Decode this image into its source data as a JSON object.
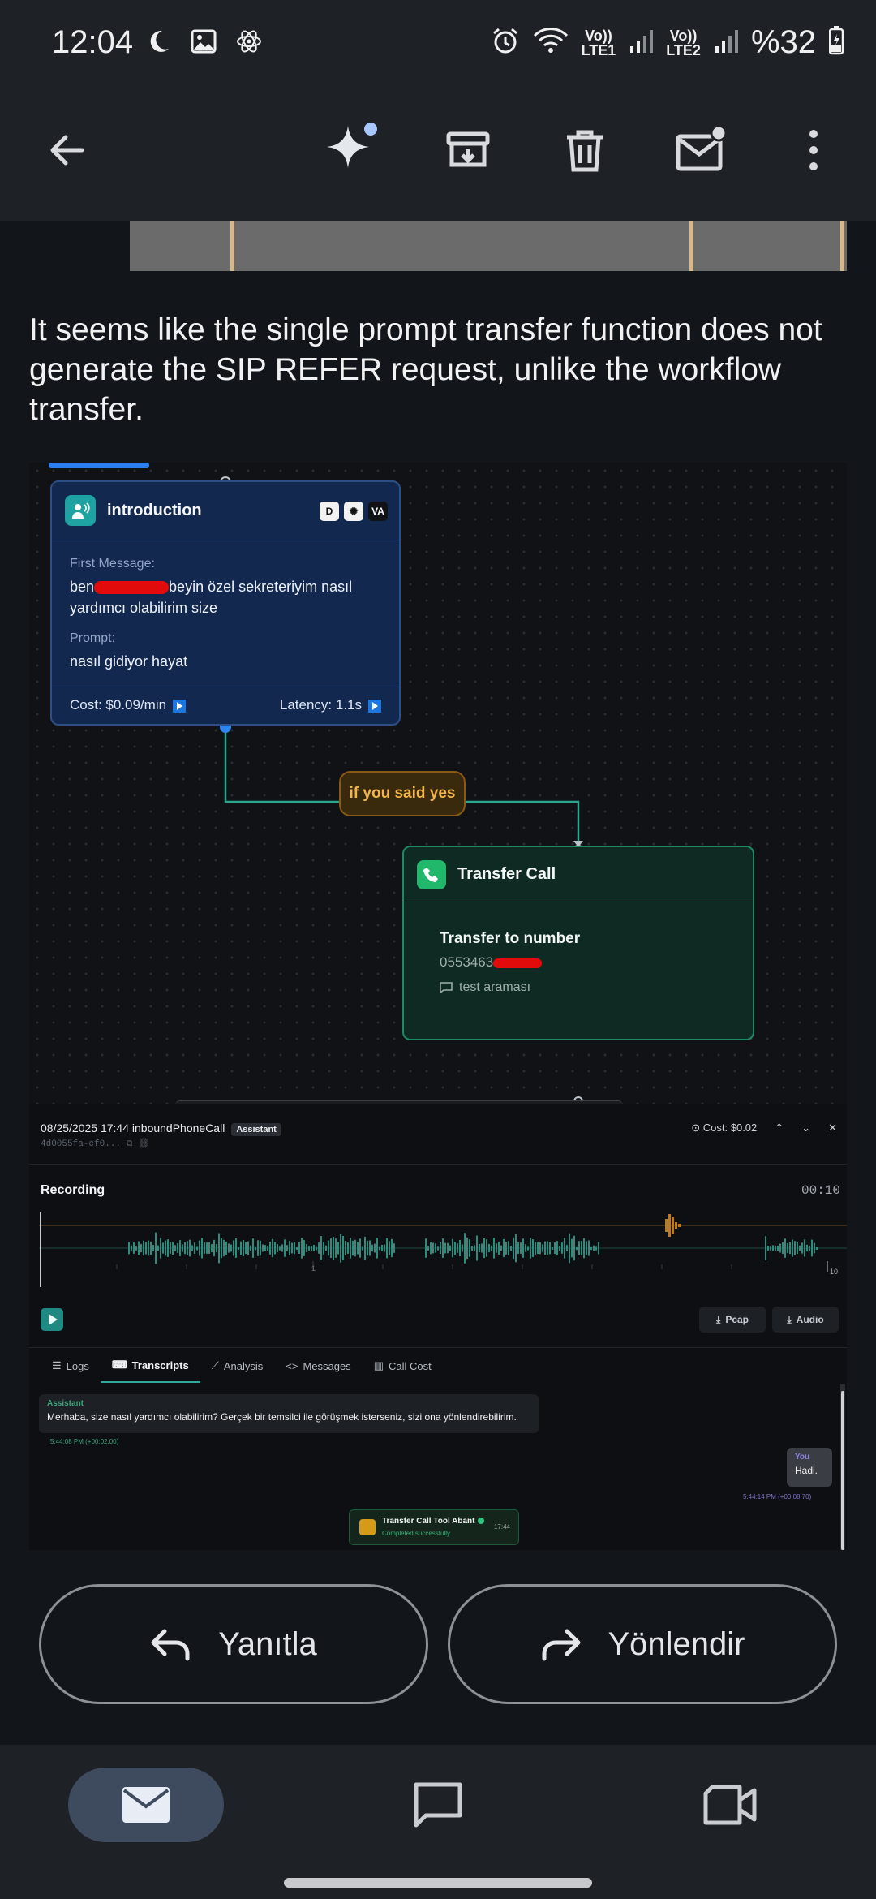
{
  "status_bar": {
    "time": "12:04",
    "lte1": "Vo))\nLTE1",
    "lte2": "Vo))\nLTE2",
    "battery": "%32",
    "icons": [
      "moon-icon",
      "image-icon",
      "atom-icon",
      "alarm-icon",
      "wifi-icon",
      "signal-icon",
      "battery-icon"
    ]
  },
  "toolbar": {
    "icons": [
      "back-arrow-icon",
      "sparkle-icon",
      "archive-icon",
      "trash-icon",
      "mark-unread-icon",
      "more-vert-icon"
    ]
  },
  "message": {
    "paragraph": "It seems like the single prompt transfer function does not generate the SIP REFER request, unlike the workflow transfer."
  },
  "workflow": {
    "intro_node": {
      "title": "introduction",
      "first_message_label": "First Message:",
      "first_message_prefix": "ben",
      "first_message_rest": "beyin özel sekreteriyim nasıl yardımcı olabilirim size",
      "prompt_label": "Prompt:",
      "prompt_value": "nasıl gidiyor hayat",
      "cost_label": "Cost:",
      "cost_value": "$0.09/min",
      "latency_label": "Latency:",
      "latency_value": "1.1s"
    },
    "edge_label": "if you said yes",
    "transfer_node": {
      "title": "Transfer Call",
      "subtitle": "Transfer to number",
      "number_prefix": "0553463",
      "note": "test araması"
    }
  },
  "call_panel": {
    "header": "08/25/2025 17:44 inboundPhoneCall",
    "assistant_badge": "Assistant",
    "call_id": "4d0055fa-cf0...",
    "cost": "Cost: $0.02",
    "recording_title": "Recording",
    "recording_time": "00:10",
    "axis_start": "1",
    "axis_end": "10",
    "pcap_label": "Pcap",
    "audio_label": "Audio",
    "tabs": [
      "Logs",
      "Transcripts",
      "Analysis",
      "Messages",
      "Call Cost"
    ],
    "active_tab": "Transcripts",
    "transcript": {
      "assistant_name": "Assistant",
      "assistant_text": "Merhaba, size nasıl yardımcı olabilirim? Gerçek bir temsilci ile görüşmek isterseniz, sizi ona yönlendirebilirim.",
      "assistant_time": "5:44:08 PM (+00:02.00)",
      "you_name": "You",
      "you_text": "Hadi.",
      "you_time": "5:44:14 PM (+00:08.70)",
      "tool_title": "Transfer Call Tool Abant",
      "tool_status": "Completed successfully",
      "tool_time": "17:44"
    }
  },
  "actions": {
    "reply": "Yanıtla",
    "forward": "Yönlendir"
  },
  "bottom_nav": {
    "items": [
      "mail-icon",
      "chat-icon",
      "video-icon"
    ],
    "active": "mail-icon"
  }
}
